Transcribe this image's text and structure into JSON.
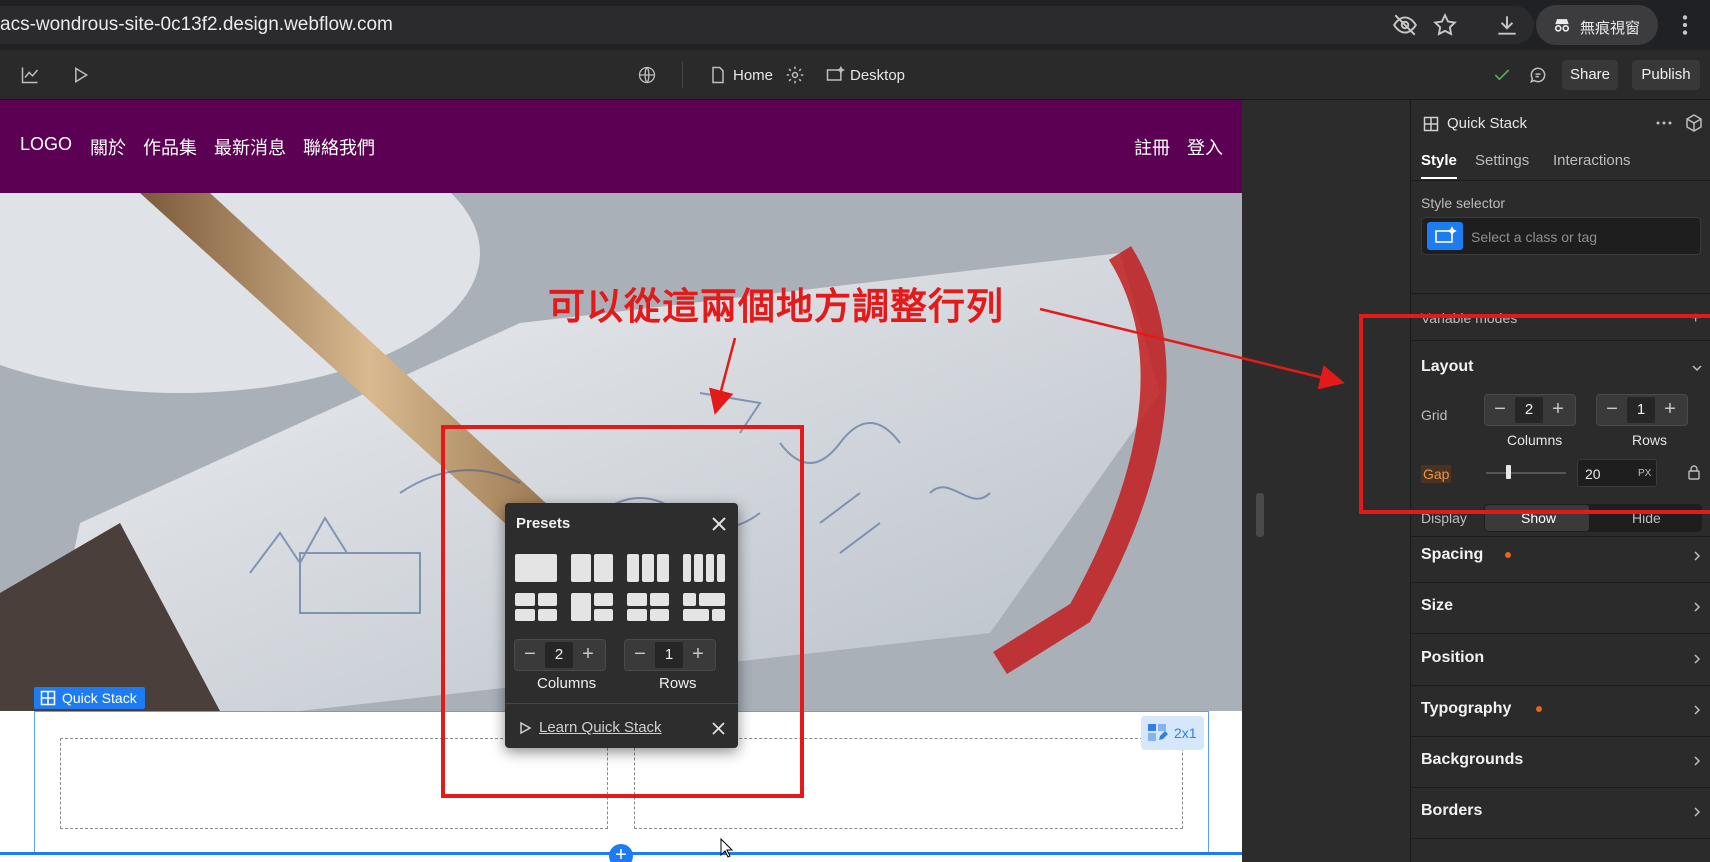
{
  "browser": {
    "url": "acs-wondrous-site-0c13f2.design.webflow.com",
    "incognito_label": "無痕視窗",
    "icons": [
      "eye-off-icon",
      "star-icon",
      "download-icon",
      "incognito-icon",
      "kebab-menu-icon"
    ]
  },
  "toolbar": {
    "page_label": "Home",
    "breakpoint_label": "Desktop",
    "share_label": "Share",
    "publish_label": "Publish"
  },
  "site": {
    "logo": "LOGO",
    "nav_links": [
      "關於",
      "作品集",
      "最新消息",
      "聯絡我們"
    ],
    "register": "註冊",
    "login": "登入"
  },
  "canvas": {
    "selected_label": "Quick Stack",
    "grid_badge": "2x1"
  },
  "presets_popup": {
    "title": "Presets",
    "columns_value": "2",
    "rows_value": "1",
    "columns_label": "Columns",
    "rows_label": "Rows",
    "learn_link": "Learn Quick Stack"
  },
  "panel": {
    "element_name": "Quick Stack",
    "tabs": [
      "Style",
      "Settings",
      "Interactions"
    ],
    "active_tab": "Style",
    "style_selector_label": "Style selector",
    "style_selector_placeholder": "Select a class or tag",
    "variable_modes": "Variable modes",
    "layout": {
      "title": "Layout",
      "grid_label": "Grid",
      "columns_value": "2",
      "rows_value": "1",
      "columns_label": "Columns",
      "rows_label": "Rows",
      "gap_label": "Gap",
      "gap_value": "20",
      "gap_unit": "PX",
      "gap_slider_fraction": 0.27
    },
    "display": {
      "label": "Display",
      "options": [
        "Show",
        "Hide"
      ],
      "selected": "Show"
    },
    "sections": [
      {
        "title": "Spacing",
        "modified": true
      },
      {
        "title": "Size",
        "modified": false
      },
      {
        "title": "Position",
        "modified": false
      },
      {
        "title": "Typography",
        "modified": true
      },
      {
        "title": "Backgrounds",
        "modified": false
      },
      {
        "title": "Borders",
        "modified": false
      }
    ]
  },
  "annotation": {
    "text": "可以從這兩個地方調整行列",
    "color": "#e41a1a"
  },
  "colors": {
    "nav_background": "#5b0052",
    "accent_blue": "#1e7cf2",
    "modified_dot": "#e8651a"
  }
}
